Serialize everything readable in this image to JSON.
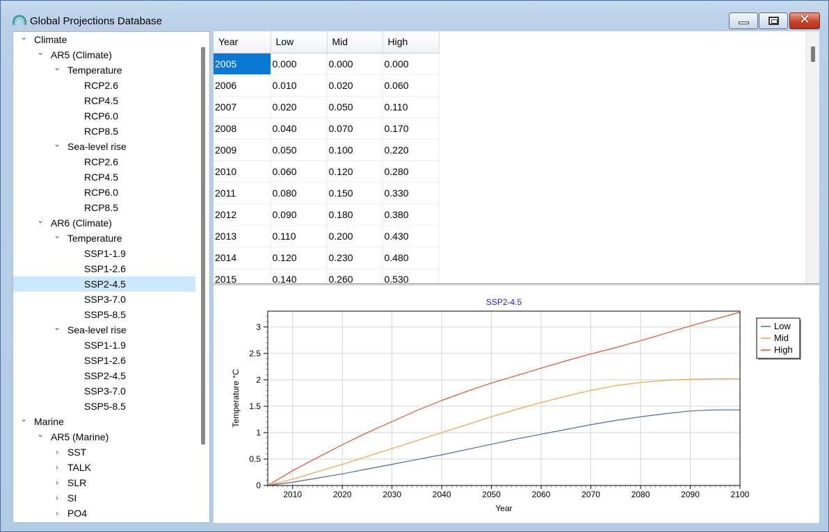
{
  "window": {
    "title": "Global Projections Database",
    "controls": {
      "minimize": "minimize",
      "maximize": "maximize",
      "close": "✕"
    }
  },
  "tree": {
    "selected": "SSP2-4.5",
    "items": [
      {
        "label": "Climate",
        "level": 0,
        "twisty": "expanded"
      },
      {
        "label": "AR5 (Climate)",
        "level": 1,
        "twisty": "expanded"
      },
      {
        "label": "Temperature",
        "level": 2,
        "twisty": "expanded"
      },
      {
        "label": "RCP2.6",
        "level": 3,
        "twisty": "none"
      },
      {
        "label": "RCP4.5",
        "level": 3,
        "twisty": "none"
      },
      {
        "label": "RCP6.0",
        "level": 3,
        "twisty": "none"
      },
      {
        "label": "RCP8.5",
        "level": 3,
        "twisty": "none"
      },
      {
        "label": "Sea-level rise",
        "level": 2,
        "twisty": "expanded"
      },
      {
        "label": "RCP2.6",
        "level": 3,
        "twisty": "none"
      },
      {
        "label": "RCP4.5",
        "level": 3,
        "twisty": "none"
      },
      {
        "label": "RCP6.0",
        "level": 3,
        "twisty": "none"
      },
      {
        "label": "RCP8.5",
        "level": 3,
        "twisty": "none"
      },
      {
        "label": "AR6 (Climate)",
        "level": 1,
        "twisty": "expanded"
      },
      {
        "label": "Temperature",
        "level": 2,
        "twisty": "expanded"
      },
      {
        "label": "SSP1-1.9",
        "level": 3,
        "twisty": "none"
      },
      {
        "label": "SSP1-2.6",
        "level": 3,
        "twisty": "none"
      },
      {
        "label": "SSP2-4.5",
        "level": 3,
        "twisty": "none",
        "selected": true
      },
      {
        "label": "SSP3-7.0",
        "level": 3,
        "twisty": "none"
      },
      {
        "label": "SSP5-8.5",
        "level": 3,
        "twisty": "none"
      },
      {
        "label": "Sea-level rise",
        "level": 2,
        "twisty": "expanded"
      },
      {
        "label": "SSP1-1.9",
        "level": 3,
        "twisty": "none"
      },
      {
        "label": "SSP1-2.6",
        "level": 3,
        "twisty": "none"
      },
      {
        "label": "SSP2-4.5",
        "level": 3,
        "twisty": "none"
      },
      {
        "label": "SSP3-7.0",
        "level": 3,
        "twisty": "none"
      },
      {
        "label": "SSP5-8.5",
        "level": 3,
        "twisty": "none"
      },
      {
        "label": "Marine",
        "level": 0,
        "twisty": "expanded"
      },
      {
        "label": "AR5 (Marine)",
        "level": 1,
        "twisty": "expanded"
      },
      {
        "label": "SST",
        "level": 2,
        "twisty": "collapsed"
      },
      {
        "label": "TALK",
        "level": 2,
        "twisty": "collapsed"
      },
      {
        "label": "SLR",
        "level": 2,
        "twisty": "collapsed"
      },
      {
        "label": "SI",
        "level": 2,
        "twisty": "collapsed"
      },
      {
        "label": "PO4",
        "level": 2,
        "twisty": "collapsed"
      }
    ]
  },
  "table": {
    "columns": [
      "Year",
      "Low",
      "Mid",
      "High"
    ],
    "selected_cell": "2005",
    "rows": [
      [
        "2005",
        "0.000",
        "0.000",
        "0.000"
      ],
      [
        "2006",
        "0.010",
        "0.020",
        "0.060"
      ],
      [
        "2007",
        "0.020",
        "0.050",
        "0.110"
      ],
      [
        "2008",
        "0.040",
        "0.070",
        "0.170"
      ],
      [
        "2009",
        "0.050",
        "0.100",
        "0.220"
      ],
      [
        "2010",
        "0.060",
        "0.120",
        "0.280"
      ],
      [
        "2011",
        "0.080",
        "0.150",
        "0.330"
      ],
      [
        "2012",
        "0.090",
        "0.180",
        "0.380"
      ],
      [
        "2013",
        "0.110",
        "0.200",
        "0.430"
      ],
      [
        "2014",
        "0.120",
        "0.230",
        "0.480"
      ],
      [
        "2015",
        "0.140",
        "0.260",
        "0.530"
      ]
    ]
  },
  "chart_data": {
    "type": "line",
    "title": "SSP2-4.5",
    "xlabel": "Year",
    "ylabel": "Temperature °C",
    "xlim": [
      2005,
      2100
    ],
    "ylim": [
      0,
      3.3
    ],
    "xticks": [
      2010,
      2020,
      2030,
      2040,
      2050,
      2060,
      2070,
      2080,
      2090,
      2100
    ],
    "yticks": [
      0,
      0.5,
      1,
      1.5,
      2,
      2.5,
      3
    ],
    "grid": true,
    "legend": "top-right",
    "x": [
      2005,
      2010,
      2015,
      2020,
      2025,
      2030,
      2035,
      2040,
      2045,
      2050,
      2055,
      2060,
      2065,
      2070,
      2075,
      2080,
      2085,
      2090,
      2095,
      2100
    ],
    "series": [
      {
        "name": "Low",
        "color": "#4a6aa5",
        "values": [
          0,
          0.06,
          0.14,
          0.22,
          0.31,
          0.4,
          0.49,
          0.58,
          0.68,
          0.78,
          0.88,
          0.97,
          1.06,
          1.15,
          1.23,
          1.3,
          1.36,
          1.41,
          1.43,
          1.43
        ]
      },
      {
        "name": "Mid",
        "color": "#f0a243",
        "values": [
          0,
          0.12,
          0.26,
          0.4,
          0.55,
          0.7,
          0.85,
          1.0,
          1.15,
          1.3,
          1.44,
          1.57,
          1.69,
          1.8,
          1.89,
          1.95,
          1.99,
          2.01,
          2.02,
          2.02
        ]
      },
      {
        "name": "High",
        "color": "#e2522a",
        "values": [
          0,
          0.28,
          0.53,
          0.77,
          1.0,
          1.21,
          1.42,
          1.61,
          1.78,
          1.94,
          2.08,
          2.22,
          2.36,
          2.49,
          2.61,
          2.74,
          2.88,
          3.02,
          3.15,
          3.28
        ]
      }
    ]
  }
}
